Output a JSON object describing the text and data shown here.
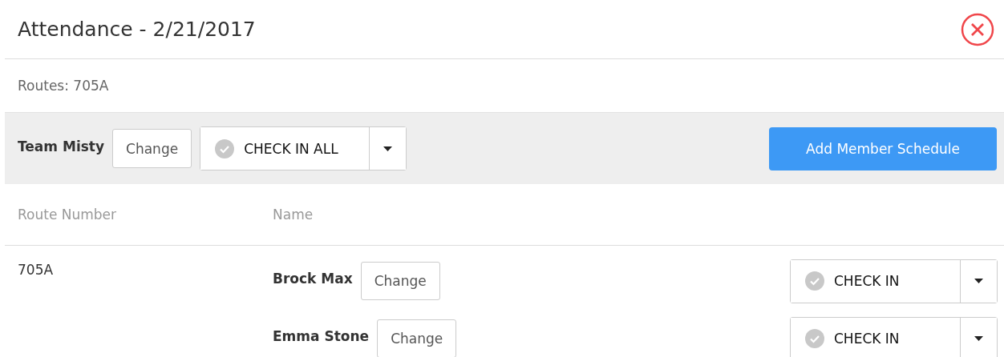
{
  "title": "Attendance - 2/21/2017",
  "routes_label": "Routes: 705A",
  "team": {
    "name": "Team Misty",
    "change": "Change",
    "check_all": {
      "label": "CHECK IN ALL",
      "checked": false
    },
    "add_button": "Add Member Schedule"
  },
  "table": {
    "columns": [
      "Route Number",
      "Name"
    ],
    "rows": [
      {
        "route": "705A",
        "members": [
          {
            "name": "Brock Max",
            "change": "Change",
            "check_in": {
              "label": "CHECK IN",
              "checked": false
            }
          },
          {
            "name": "Emma Stone",
            "change": "Change",
            "check_in": {
              "label": "CHECK IN",
              "checked": false
            }
          }
        ]
      }
    ]
  }
}
